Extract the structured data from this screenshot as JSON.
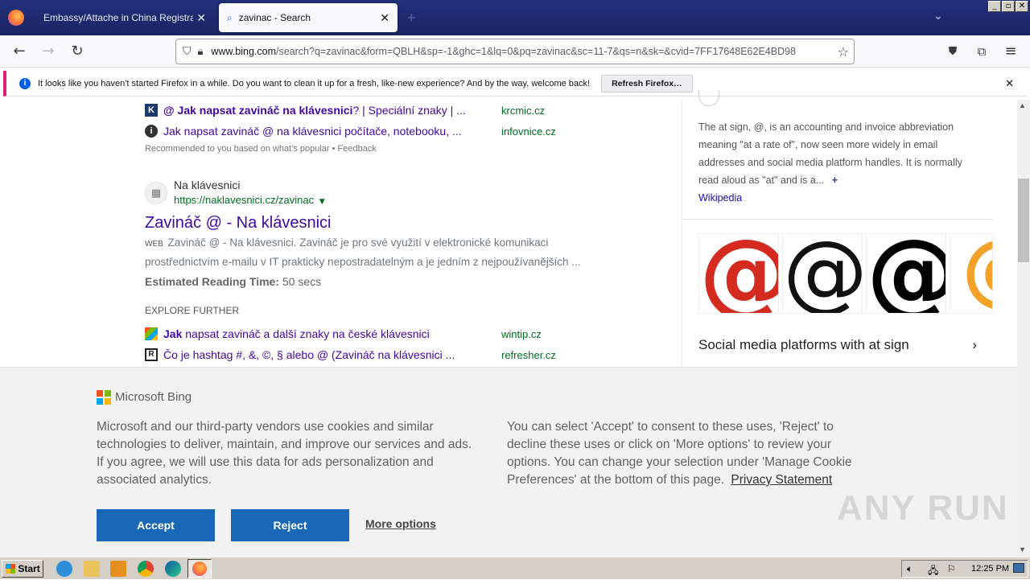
{
  "browser": {
    "tabs": [
      {
        "title": "Embassy/Attache in China Registration"
      },
      {
        "title": "zavinac - Search"
      }
    ],
    "url_host": "www.bing.com",
    "url_path": "/search?q=zavinac&form=QBLH&sp=-1&ghc=1&lq=0&pq=zavinac&sc=11-7&qs=n&sk=&cvid=7FF17648E62E4BD98"
  },
  "notification": {
    "text": "It looks like you haven't started Firefox in a while. Do you want to clean it up for a fresh, like-new experience? And by the way, welcome back!",
    "button": "Refresh Firefox…"
  },
  "results": {
    "top_links": [
      {
        "bold": "@ Jak napsat zavináč na klávesnici",
        "rest": "? | Speciální znaky | ...",
        "source": "krcmic.cz"
      },
      {
        "bold": "",
        "rest": "Jak napsat zavináč @ na klávesnici počítače, notebooku, ...",
        "source": "infovnice.cz"
      }
    ],
    "recommended": "Recommended to you based on what's popular • Feedback",
    "main": {
      "site_name": "Na klávesnici",
      "site_url": "https://naklavesnici.cz/zavinac",
      "title": "Zavináč @ - Na klávesnici",
      "web_label": "WEB",
      "snippet1": "Zavináč @ - Na klávesnici. Zavináč je pro své využití v elektronické komunikaci",
      "snippet2": "prostřednictvím e-mailu v IT prakticky nepostradatelným a je jedním z nejpoužívanějších ...",
      "reading_label": "Estimated Reading Time:",
      "reading_value": "50 secs"
    },
    "explore_heading": "EXPLORE FURTHER",
    "explore": [
      {
        "bold": "Jak",
        "rest": " napsat zavináč a další znaky na české klávesnici",
        "source": "wintip.cz"
      },
      {
        "bold": "",
        "rest": "Čo je hashtag #, &, ©, § alebo @ (Zavináč na klávesnici ...",
        "source": "refresher.cz"
      }
    ]
  },
  "panel": {
    "description": "The at sign, @, is an accounting and invoice abbreviation meaning \"at a rate of\", now seen more widely in email addresses and social media platform handles. It is normally read aloud as \"at\" and is a...",
    "more": "+",
    "source": "Wikipedia",
    "related": "Social media platforms with at sign"
  },
  "cookie": {
    "brand": "Microsoft Bing",
    "left_text": "Microsoft and our third-party vendors use cookies and similar technologies to deliver, maintain, and improve our services and ads. If you agree, we will use this data for ads personalization and associated analytics.",
    "right_text": "You can select 'Accept' to consent to these uses, 'Reject' to decline these uses or click on 'More options' to review your options. You can change your selection under 'Manage Cookie Preferences' at the bottom of this page.",
    "privacy": "Privacy Statement",
    "accept": "Accept",
    "reject": "Reject",
    "more": "More options"
  },
  "watermark": "ANY RUN",
  "taskbar": {
    "start": "Start",
    "time": "12:25 PM"
  }
}
